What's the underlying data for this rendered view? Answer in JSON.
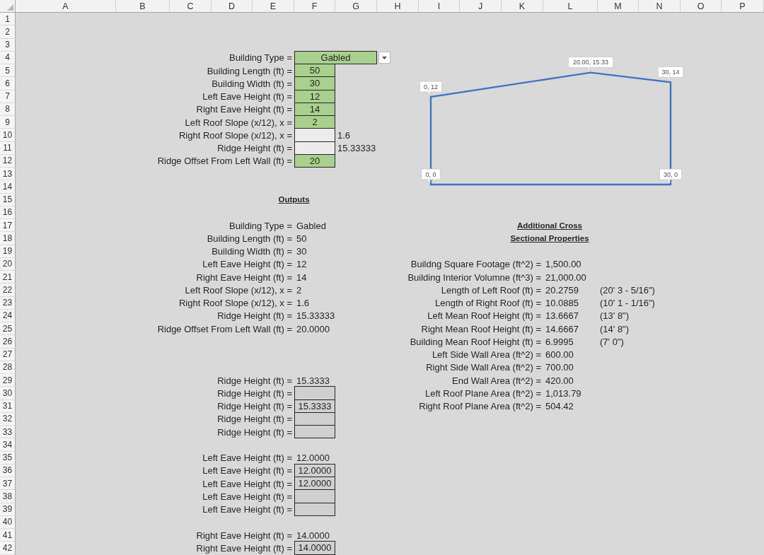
{
  "column_headers": [
    "A",
    "B",
    "C",
    "D",
    "E",
    "F",
    "G",
    "H",
    "I",
    "J",
    "K",
    "L",
    "M",
    "N",
    "O",
    "P"
  ],
  "row_numbers": [
    "1",
    "2",
    "3",
    "4",
    "5",
    "6",
    "7",
    "8",
    "9",
    "10",
    "11",
    "12",
    "13",
    "14",
    "15",
    "16",
    "17",
    "18",
    "19",
    "20",
    "21",
    "22",
    "23",
    "24",
    "25",
    "26",
    "27",
    "28",
    "29",
    "30",
    "31",
    "32",
    "33",
    "34",
    "35",
    "36",
    "37",
    "38",
    "39",
    "40",
    "41",
    "42"
  ],
  "inputs": [
    {
      "label": "Building Type =",
      "value": "Gabled",
      "kind": "dropdown",
      "highlighted": true
    },
    {
      "label": "Building Length (ft) =",
      "value": "50",
      "kind": "number",
      "highlighted": true
    },
    {
      "label": "Building Width (ft) =",
      "value": "30",
      "kind": "number",
      "highlighted": true
    },
    {
      "label": "Left Eave Height (ft) =",
      "value": "12",
      "kind": "number",
      "highlighted": true
    },
    {
      "label": "Right Eave Height (ft) =",
      "value": "14",
      "kind": "number",
      "highlighted": true
    },
    {
      "label": "Left Roof Slope (x/12), x =",
      "value": "2",
      "kind": "number",
      "highlighted": true
    },
    {
      "label": "Right Roof Slope (x/12), x =",
      "kind": "number",
      "highlighted": false,
      "side_value": "1.6"
    },
    {
      "label": "Ridge Height (ft) =",
      "kind": "number",
      "highlighted": false,
      "side_value": "15.33333"
    },
    {
      "label": "Ridge Offset From Left Wall (ft) =",
      "value": "20",
      "kind": "number",
      "highlighted": true
    }
  ],
  "cross_section": {
    "point_labels": [
      "0, 0",
      "0, 12",
      "20.00, 15.33",
      "30, 14",
      "30, 0"
    ]
  },
  "outputs": {
    "heading": "Outputs",
    "rows": [
      {
        "label": "Building Type =",
        "value": "Gabled"
      },
      {
        "label": "Building Length (ft) =",
        "value": "50"
      },
      {
        "label": "Building Width (ft) =",
        "value": "30"
      },
      {
        "label": "Left Eave Height (ft) =",
        "value": "12"
      },
      {
        "label": "Right Eave Height (ft) =",
        "value": "14"
      },
      {
        "label": "Left Roof Slope (x/12), x =",
        "value": "2"
      },
      {
        "label": "Right Roof Slope (x/12), x =",
        "value": "1.6"
      },
      {
        "label": "Ridge Height (ft) =",
        "value": "15.33333"
      },
      {
        "label": "Ridge Offset From Left Wall (ft) =",
        "value": "20.0000"
      }
    ]
  },
  "properties": {
    "heading_lines": [
      "Additional Cross",
      "Sectional Properties"
    ],
    "rows": [
      {
        "label": "Buildng Square Footage (ft^2) =",
        "value": "1,500.00"
      },
      {
        "label": "Building Interior Volumne (ft^3) =",
        "value": "21,000.00"
      },
      {
        "label": "Length of Left Roof (ft) =",
        "value": "20.2759",
        "note": "(20' 3 - 5/16\")"
      },
      {
        "label": "Length of Right Roof (ft) =",
        "value": "10.0885",
        "note": "(10' 1 - 1/16\")"
      },
      {
        "label": "Left Mean Roof Height (ft) =",
        "value": "13.6667",
        "note": "(13' 8\")"
      },
      {
        "label": "Right Mean Roof Height (ft) =",
        "value": "14.6667",
        "note": "(14' 8\")"
      },
      {
        "label": "Building Mean Roof Height (ft) =",
        "value": "6.9995",
        "note": "(7' 0\")"
      },
      {
        "label": "Left Side Wall Area (ft^2) =",
        "value": "600.00"
      },
      {
        "label": "Right Side Wall Area (ft^2) =",
        "value": "700.00"
      },
      {
        "label": "End Wall Area (ft^2) =",
        "value": "420.00"
      },
      {
        "label": "Left Roof Plane Area (ft^2) =",
        "value": "1,013.79"
      },
      {
        "label": "Right Roof Plane Area (ft^2) =",
        "value": "504.42"
      }
    ]
  },
  "checks": [
    {
      "rows": [
        {
          "label": "Ridge Height (ft) =",
          "value": "15.3333",
          "kind": "plain"
        },
        {
          "label": "Ridge Height (ft) =",
          "kind": "boxed"
        },
        {
          "label": "Ridge Height (ft) =",
          "value": "15.3333",
          "kind": "boxed"
        },
        {
          "label": "Ridge Height (ft) =",
          "kind": "boxed"
        },
        {
          "label": "Ridge Height (ft) =",
          "kind": "boxed"
        }
      ]
    },
    {
      "rows": [
        {
          "label": "Left Eave Height (ft) =",
          "value": "12.0000",
          "kind": "plain"
        },
        {
          "label": "Left Eave Height (ft) =",
          "value": "12.0000",
          "kind": "boxed"
        },
        {
          "label": "Left Eave Height (ft) =",
          "value": "12.0000",
          "kind": "boxed"
        },
        {
          "label": "Left Eave Height (ft) =",
          "kind": "boxed"
        },
        {
          "label": "Left Eave Height (ft) =",
          "kind": "boxed"
        }
      ]
    },
    {
      "rows": [
        {
          "label": "Right Eave Height (ft) =",
          "value": "14.0000",
          "kind": "plain"
        },
        {
          "label": "Right Eave Height (ft) =",
          "value": "14.0000",
          "kind": "boxed"
        }
      ]
    }
  ]
}
